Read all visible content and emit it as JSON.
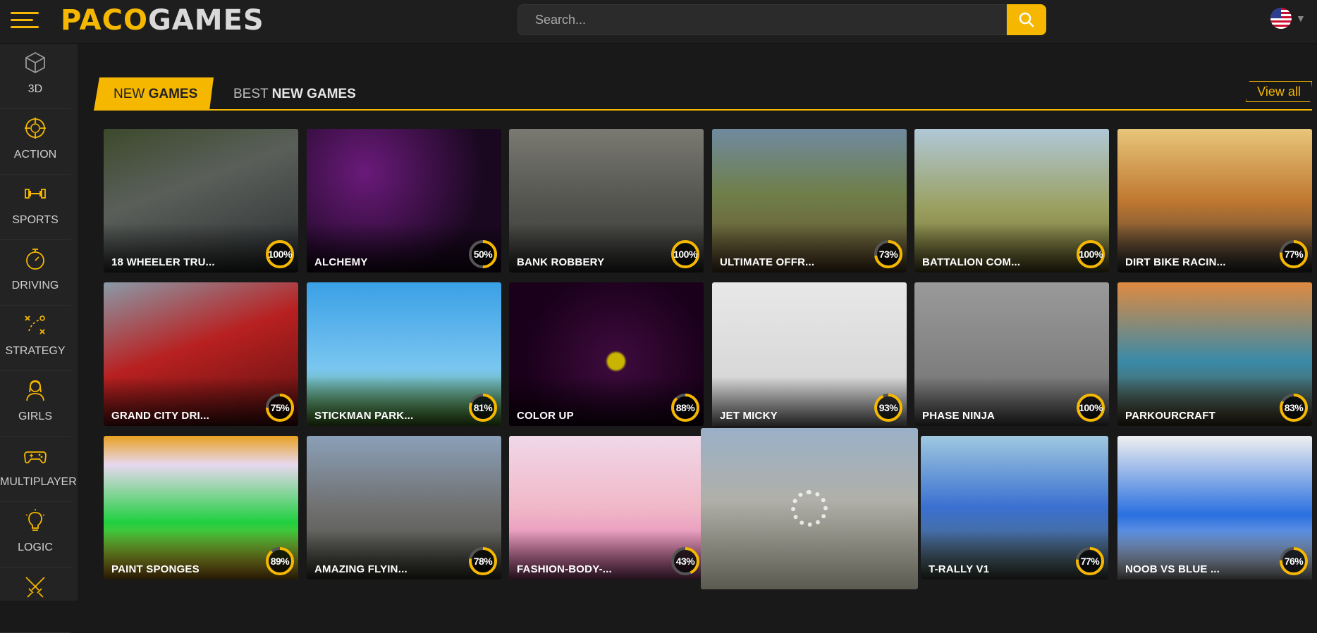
{
  "header": {
    "logo_left": "PACO",
    "logo_right": "GAMES",
    "search_placeholder": "Search...",
    "language_icon": "us-flag-icon"
  },
  "sidebar": {
    "items": [
      {
        "label": "3D",
        "icon": "cube-icon"
      },
      {
        "label": "ACTION",
        "icon": "crosshair-icon"
      },
      {
        "label": "SPORTS",
        "icon": "dumbbell-icon"
      },
      {
        "label": "DRIVING",
        "icon": "stopwatch-icon"
      },
      {
        "label": "STRATEGY",
        "icon": "strategy-icon"
      },
      {
        "label": "GIRLS",
        "icon": "girl-icon"
      },
      {
        "label": "MULTIPLAYER",
        "icon": "gamepad-icon"
      },
      {
        "label": "LOGIC",
        "icon": "lightbulb-icon"
      },
      {
        "label": "",
        "icon": "swords-icon"
      }
    ]
  },
  "tabs": {
    "new_prefix": "NEW ",
    "new_bold": "GAMES",
    "best_prefix": "BEST ",
    "best_bold": "NEW GAMES",
    "view_all": "View all"
  },
  "colors": {
    "accent": "#f5b700",
    "ring_track": "#555555"
  },
  "games": [
    {
      "title": "18 WHEELER TRU...",
      "rating": 100
    },
    {
      "title": "ALCHEMY",
      "rating": 50
    },
    {
      "title": "BANK ROBBERY",
      "rating": 100
    },
    {
      "title": "ULTIMATE OFFR...",
      "rating": 73
    },
    {
      "title": "BATTALION COM...",
      "rating": 100
    },
    {
      "title": "DIRT BIKE RACIN...",
      "rating": 77
    },
    {
      "title": "GRAND CITY DRI...",
      "rating": 75
    },
    {
      "title": "STICKMAN PARK...",
      "rating": 81
    },
    {
      "title": "COLOR UP",
      "rating": 88
    },
    {
      "title": "JET MICKY",
      "rating": 93
    },
    {
      "title": "PHASE NINJA",
      "rating": 100
    },
    {
      "title": "PARKOURCRAFT",
      "rating": 83
    },
    {
      "title": "PAINT SPONGES",
      "rating": 89
    },
    {
      "title": "AMAZING FLYIN...",
      "rating": 78
    },
    {
      "title": "FASHION-BODY-...",
      "rating": 43
    },
    {
      "title": "",
      "rating": null
    },
    {
      "title": "T-RALLY V1",
      "rating": 77
    },
    {
      "title": "NOOB VS BLUE ...",
      "rating": 76
    }
  ]
}
